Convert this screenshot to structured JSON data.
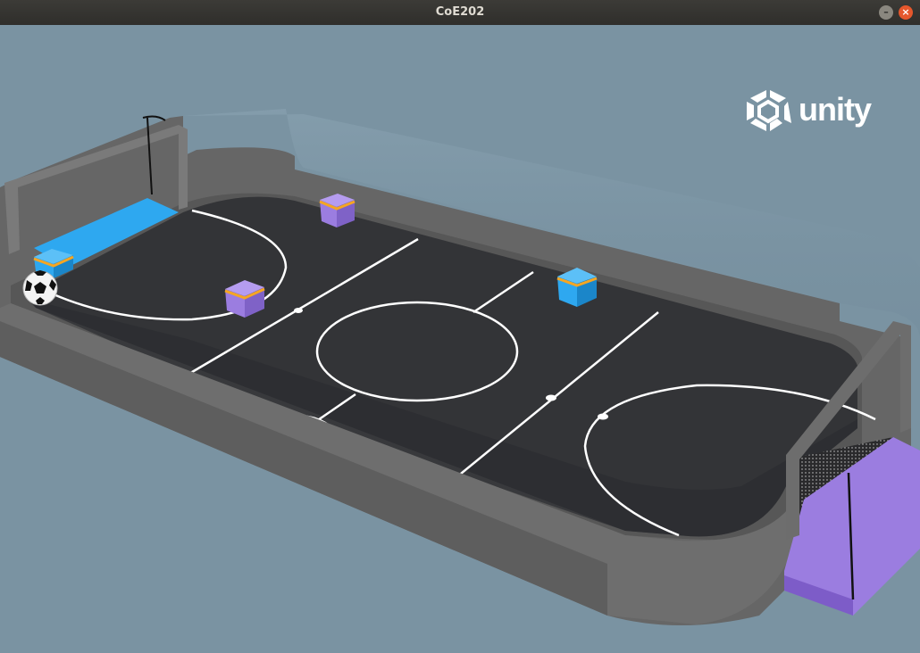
{
  "window": {
    "title": "CoE202"
  },
  "controls": {
    "minimize_glyph": "–",
    "close_glyph": "×"
  },
  "overlay": {
    "engine_logo_text": "unity"
  },
  "colors": {
    "background": "#7a93a2",
    "field": "#333437",
    "wall": "#6b6b6b",
    "blue_team": "#2ea8f0",
    "purple_team": "#9b7de0",
    "stripe": "#f5a623"
  },
  "scene": {
    "agents": [
      {
        "team": "purple",
        "id": "purple-agent-1"
      },
      {
        "team": "purple",
        "id": "purple-agent-2"
      },
      {
        "team": "blue",
        "id": "blue-agent-1"
      },
      {
        "team": "blue",
        "id": "blue-agent-2"
      }
    ],
    "ball": "soccer-ball",
    "goals": [
      "blue-goal",
      "purple-goal"
    ]
  }
}
